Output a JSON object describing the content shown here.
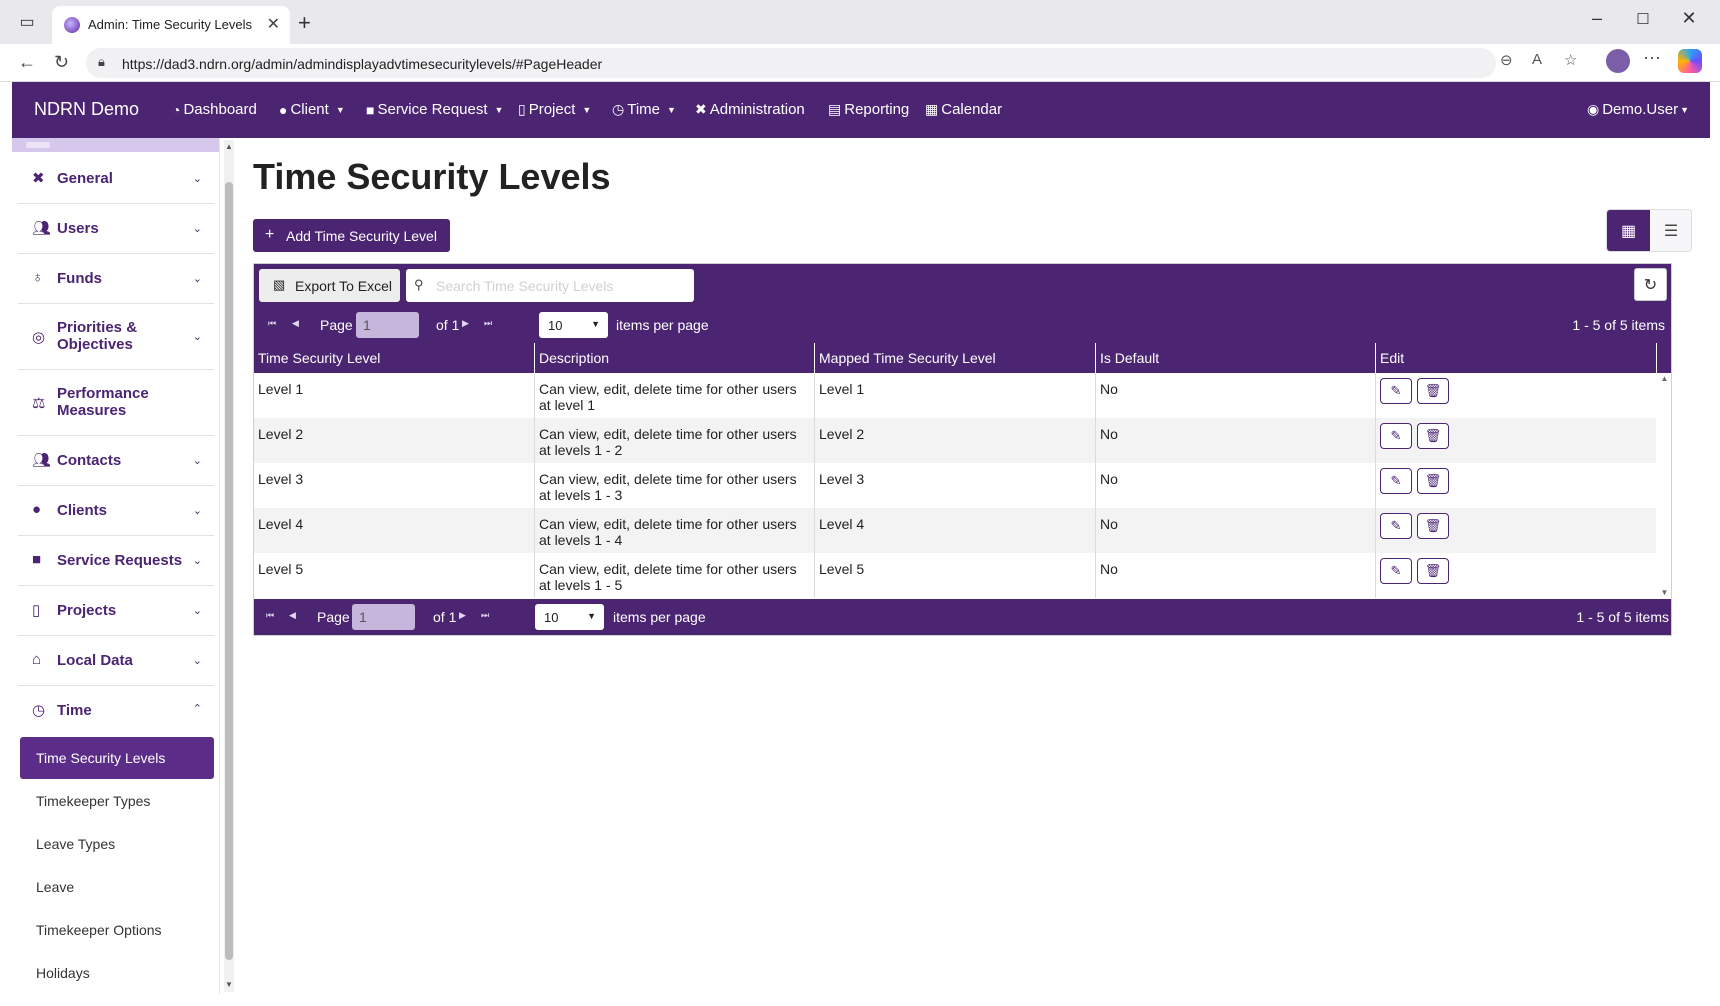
{
  "browser": {
    "tab_title": "Admin: Time Security Levels",
    "url": "https://dad3.ndrn.org/admin/admindisplayadvtimesecuritylevels/#PageHeader"
  },
  "navbar": {
    "brand": "NDRN Demo",
    "items": [
      {
        "label": "Dashboard",
        "icon": "gauge-icon"
      },
      {
        "label": "Client",
        "icon": "user-icon"
      },
      {
        "label": "Service Request",
        "icon": "briefcase-icon"
      },
      {
        "label": "Project",
        "icon": "clipboard-icon"
      },
      {
        "label": "Time",
        "icon": "clock-icon"
      },
      {
        "label": "Administration",
        "icon": "tools-icon"
      },
      {
        "label": "Reporting",
        "icon": "file-icon"
      },
      {
        "label": "Calendar",
        "icon": "calendar-icon"
      }
    ],
    "user": "Demo.User"
  },
  "sidebar": {
    "sections": [
      {
        "label": "General",
        "icon": "tools-icon"
      },
      {
        "label": "Users",
        "icon": "users-icon"
      },
      {
        "label": "Funds",
        "icon": "money-bag-icon"
      },
      {
        "label": "Priorities & Objectives",
        "icon": "target-icon"
      },
      {
        "label": "Performance Measures",
        "icon": "balance-scale-icon"
      },
      {
        "label": "Contacts",
        "icon": "users-icon"
      },
      {
        "label": "Clients",
        "icon": "user-icon"
      },
      {
        "label": "Service Requests",
        "icon": "briefcase-icon"
      },
      {
        "label": "Projects",
        "icon": "clipboard-icon"
      },
      {
        "label": "Local Data",
        "icon": "house-lock-icon"
      },
      {
        "label": "Time",
        "icon": "clock-icon"
      }
    ],
    "time_items": [
      "Time Security Levels",
      "Timekeeper Types",
      "Leave Types",
      "Leave",
      "Timekeeper Options",
      "Holidays"
    ]
  },
  "main": {
    "title": "Time Security Levels",
    "add_button": "Add Time Security Level",
    "export_button": "Export To Excel",
    "search_placeholder": "Search Time Security Levels",
    "pager": {
      "page_label": "Page",
      "page_value": "1",
      "of_label": "of 1",
      "page_size": "10",
      "items_per_page": "items per page",
      "info": "1 - 5 of 5 items"
    },
    "columns": [
      "Time Security Level",
      "Description",
      "Mapped Time Security Level",
      "Is Default",
      "Edit"
    ],
    "rows": [
      {
        "level": "Level 1",
        "desc_line1": "Can view, edit, delete time for other users",
        "desc_line2": "at level 1",
        "mapped": "Level 1",
        "default": "No"
      },
      {
        "level": "Level 2",
        "desc_line1": "Can view, edit, delete time for other users",
        "desc_line2": "at levels 1 - 2",
        "mapped": "Level 2",
        "default": "No"
      },
      {
        "level": "Level 3",
        "desc_line1": "Can view, edit, delete time for other users",
        "desc_line2": "at levels 1 - 3",
        "mapped": "Level 3",
        "default": "No"
      },
      {
        "level": "Level 4",
        "desc_line1": "Can view, edit, delete time for other users",
        "desc_line2": "at levels 1 - 4",
        "mapped": "Level 4",
        "default": "No"
      },
      {
        "level": "Level 5",
        "desc_line1": "Can view, edit, delete time for other users",
        "desc_line2": "at levels 1 - 5",
        "mapped": "Level 5",
        "default": "No"
      }
    ]
  },
  "colors": {
    "brand_purple": "#4b2472",
    "active_item": "#5b2d88",
    "pager_input": "#c7b6db"
  }
}
